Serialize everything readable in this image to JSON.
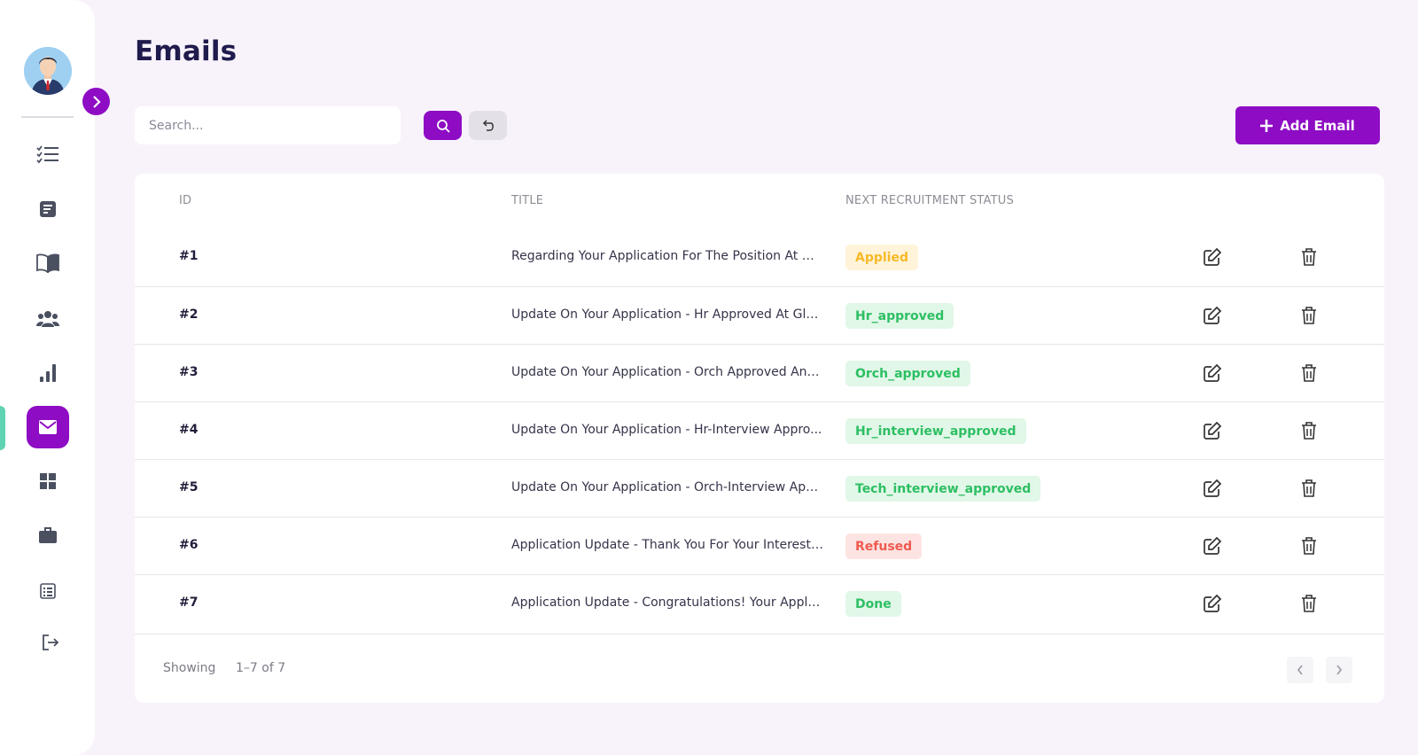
{
  "page": {
    "title": "Emails"
  },
  "search": {
    "placeholder": "Search..."
  },
  "toolbar": {
    "add_label": "Add Email"
  },
  "table": {
    "headers": {
      "id": "ID",
      "title": "TITLE",
      "status": "NEXT RECRUITMENT STATUS"
    },
    "rows": [
      {
        "id": "#1",
        "title": "Regarding Your Application For The Position At Glo...",
        "status": "Applied",
        "status_color": "yellow"
      },
      {
        "id": "#2",
        "title": "Update On Your Application - Hr Approved At Glo...",
        "status": "Hr_approved",
        "status_color": "green"
      },
      {
        "id": "#3",
        "title": "Update On Your Application - Orch Approved And...",
        "status": "Orch_approved",
        "status_color": "green"
      },
      {
        "id": "#4",
        "title": "Update On Your Application - Hr-Interview Appro...",
        "status": "Hr_interview_approved",
        "status_color": "green"
      },
      {
        "id": "#5",
        "title": "Update On Your Application - Orch-Interview App...",
        "status": "Tech_interview_approved",
        "status_color": "green"
      },
      {
        "id": "#6",
        "title": "Application Update - Thank You For Your Interest I...",
        "status": "Refused",
        "status_color": "red"
      },
      {
        "id": "#7",
        "title": "Application Update - Congratulations! Your Applic...",
        "status": "Done",
        "status_color": "green"
      }
    ]
  },
  "pagination": {
    "showing_label": "Showing",
    "range": "1–7 of 7"
  },
  "sidebar": {
    "items": [
      {
        "icon": "checklist-icon"
      },
      {
        "icon": "note-icon"
      },
      {
        "icon": "book-icon"
      },
      {
        "icon": "people-icon"
      },
      {
        "icon": "bar-chart-icon"
      },
      {
        "icon": "mail-icon",
        "active": true
      },
      {
        "icon": "grid-icon"
      },
      {
        "icon": "briefcase-icon"
      },
      {
        "icon": "list-icon"
      },
      {
        "icon": "logout-icon"
      }
    ]
  },
  "colors": {
    "accent": "#8e0cc4",
    "background": "#f8f3fb",
    "badge_yellow": "#f7b928",
    "badge_green": "#2dbf63",
    "badge_red": "#ef5a50"
  }
}
